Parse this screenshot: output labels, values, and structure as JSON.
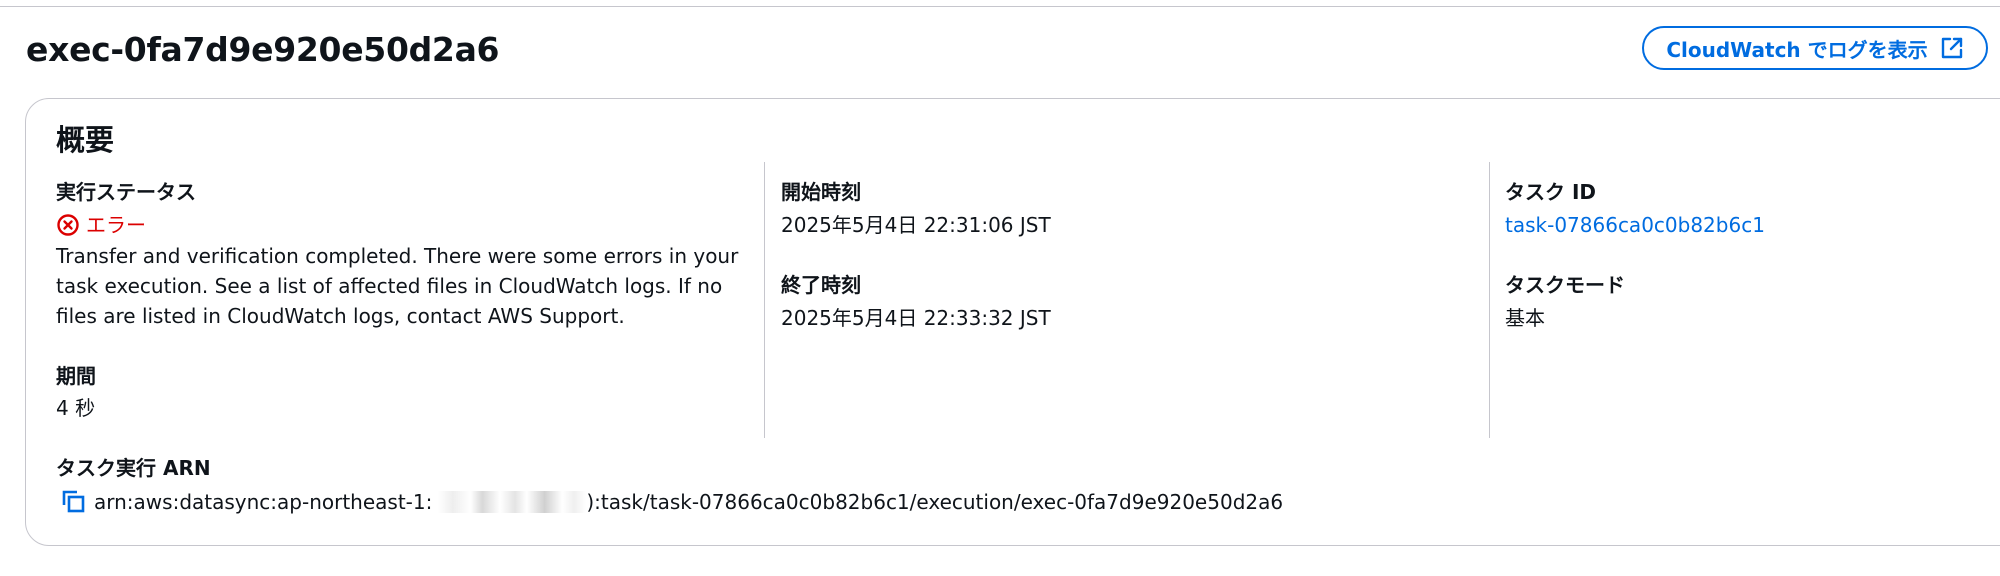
{
  "header": {
    "title": "exec-0fa7d9e920e50d2a6",
    "cloudwatch_button_label": "CloudWatch でログを表示"
  },
  "summary": {
    "title": "概要",
    "status": {
      "label": "実行ステータス",
      "value": "エラー",
      "description": "Transfer and verification completed. There were some errors in your task execution. See a list of affected files in CloudWatch logs. If no files are listed in CloudWatch logs, contact AWS Support."
    },
    "duration": {
      "label": "期間",
      "value": "4 秒"
    },
    "start_time": {
      "label": "開始時刻",
      "value": "2025年5月4日 22:31:06 JST"
    },
    "end_time": {
      "label": "終了時刻",
      "value": "2025年5月4日 22:33:32 JST"
    },
    "task_id": {
      "label": "タスク ID",
      "value": "task-07866ca0c0b82b6c1"
    },
    "task_mode": {
      "label": "タスクモード",
      "value": "基本"
    },
    "arn": {
      "label": "タスク実行 ARN",
      "prefix": "arn:aws:datasync:ap-northeast-1:",
      "suffix": "):task/task-07866ca0c0b82b6c1/execution/exec-0fa7d9e920e50d2a6"
    }
  },
  "colors": {
    "accent": "#006ce0",
    "error": "#db0000",
    "border": "#c6c6cd",
    "text": "#0f141a"
  },
  "icons": {
    "external_link": "external-link-icon",
    "status_error": "status-error-icon",
    "copy": "copy-icon"
  }
}
